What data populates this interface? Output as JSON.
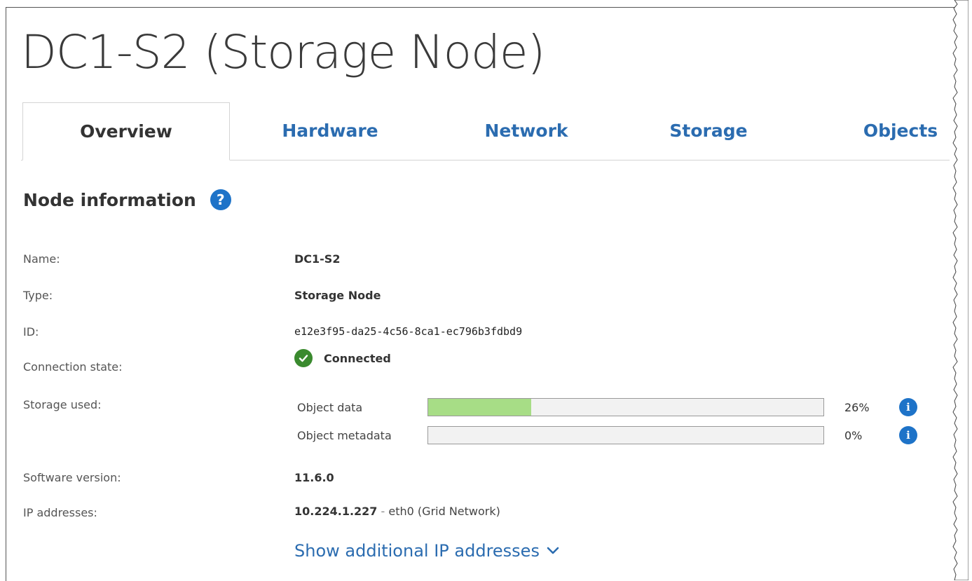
{
  "page": {
    "title": "DC1-S2 (Storage Node)"
  },
  "tabs": [
    {
      "label": "Overview",
      "active": true
    },
    {
      "label": "Hardware",
      "active": false
    },
    {
      "label": "Network",
      "active": false
    },
    {
      "label": "Storage",
      "active": false
    },
    {
      "label": "Objects",
      "active": false
    }
  ],
  "node_info": {
    "section_title": "Node information",
    "help_icon": "question-circle-icon",
    "name_label": "Name:",
    "name_value": "DC1-S2",
    "type_label": "Type:",
    "type_value": "Storage Node",
    "id_label": "ID:",
    "id_value": "e12e3f95-da25-4c56-8ca1-ec796b3fdbd9",
    "connection_label": "Connection state:",
    "connection_value": "Connected",
    "connection_icon": "check-circle-icon",
    "storage_label": "Storage used:",
    "storage": [
      {
        "label": "Object data",
        "percent_text": "26%",
        "percent": 26
      },
      {
        "label": "Object metadata",
        "percent_text": "0%",
        "percent": 0
      }
    ],
    "software_label": "Software version:",
    "software_value": "11.6.0",
    "ip_label": "IP addresses:",
    "ip_address": "10.224.1.227",
    "ip_separator": "-",
    "ip_interface": "eth0 (Grid Network)",
    "show_more_label": "Show additional IP addresses"
  },
  "colors": {
    "accent": "#2b6cb0",
    "info_blue": "#1e73c8",
    "success_green": "#3a8a2e",
    "bar_fill": "#a7dd86"
  }
}
